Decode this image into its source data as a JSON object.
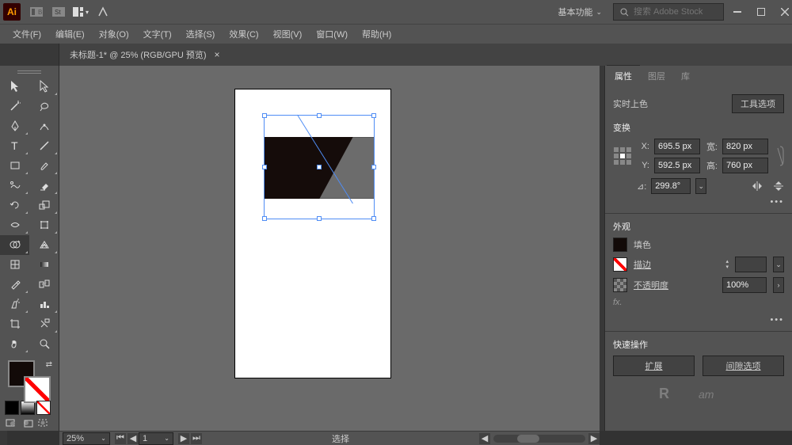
{
  "top": {
    "app_badge": "Ai",
    "workspace": "基本功能",
    "search_placeholder": "搜索 Adobe Stock"
  },
  "menu": {
    "file": "文件(F)",
    "edit": "编辑(E)",
    "object": "对象(O)",
    "type": "文字(T)",
    "select": "选择(S)",
    "effect": "效果(C)",
    "view": "视图(V)",
    "window": "窗口(W)",
    "help": "帮助(H)"
  },
  "doc_tab": {
    "title": "未标题-1* @ 25% (RGB/GPU 预览)",
    "close": "×"
  },
  "panel": {
    "tabs": {
      "properties": "属性",
      "layers": "图层",
      "libraries": "库"
    },
    "selection_type": "实时上色",
    "tool_options_btn": "工具选项",
    "transform_title": "变换",
    "x_label": "X:",
    "y_label": "Y:",
    "w_label": "宽:",
    "h_label": "高:",
    "x_val": "695.5 px",
    "y_val": "592.5 px",
    "w_val": "820 px",
    "h_val": "760 px",
    "angle_label": "⊿:",
    "angle_val": "299.8°",
    "appearance_title": "外观",
    "fill_label": "填色",
    "stroke_label": "描边",
    "opacity_label": "不透明度",
    "opacity_val": "100%",
    "fx_label": "fx.",
    "quick_title": "快速操作",
    "expand_btn": "扩展",
    "gap_opts_btn": "间隙选项"
  },
  "status": {
    "zoom": "25%",
    "artboard_num": "1",
    "mode_text": "选择"
  },
  "colors": {
    "fill_swatch": "#120a08",
    "opacity_bg": "#424242"
  }
}
